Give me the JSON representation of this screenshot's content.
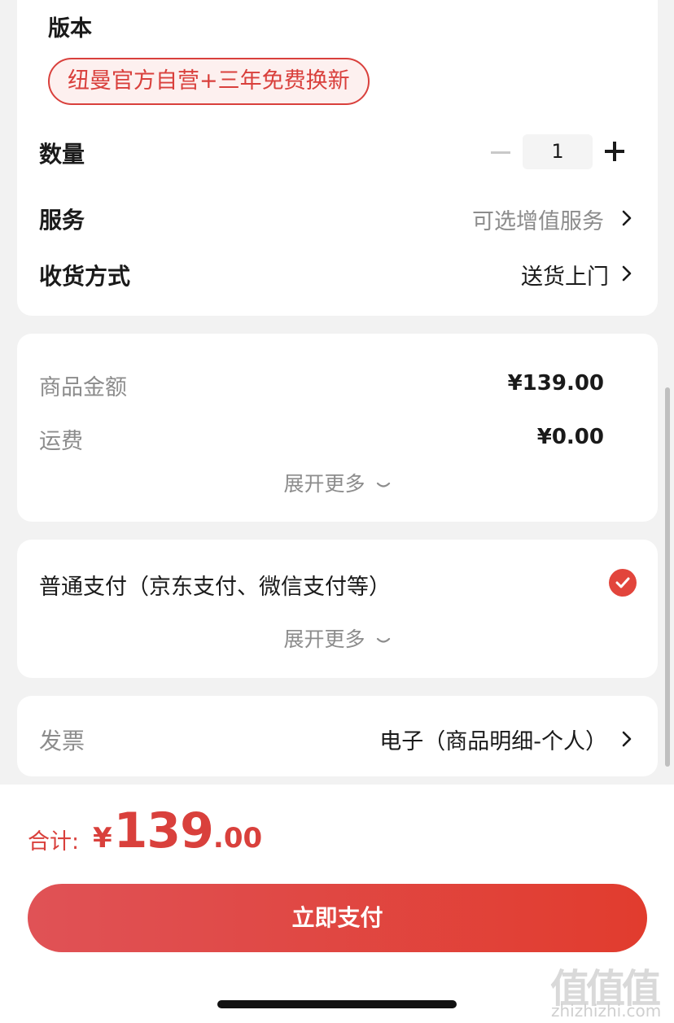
{
  "product": {
    "version_label": "版本",
    "version_option": "纽曼官方自营+三年免费换新"
  },
  "quantity": {
    "label": "数量",
    "value": "1",
    "minus_icon": "minus-icon",
    "plus_icon": "plus-icon"
  },
  "service": {
    "label": "服务",
    "value": "可选增值服务"
  },
  "shipping": {
    "label": "收货方式",
    "value": "送货上门"
  },
  "price_summary": {
    "goods_label": "商品金额",
    "goods_value": "¥139.00",
    "freight_label": "运费",
    "freight_value": "¥0.00",
    "expand_label": "展开更多"
  },
  "payment": {
    "method_label": "普通支付（京东支付、微信支付等）",
    "selected": true,
    "expand_label": "展开更多"
  },
  "invoice": {
    "label": "发票",
    "value": "电子（商品明细-个人）"
  },
  "total": {
    "label": "合计:",
    "currency": "¥",
    "integer": "139",
    "decimal": ".00"
  },
  "pay_button": {
    "label": "立即支付"
  },
  "watermark": {
    "logo": "值值值",
    "url": "zhizhizhi.com"
  },
  "colors": {
    "accent": "#e2453c",
    "chip_border": "#d9403c",
    "muted_text": "#8c8c8c",
    "background": "#f2f2f2"
  }
}
